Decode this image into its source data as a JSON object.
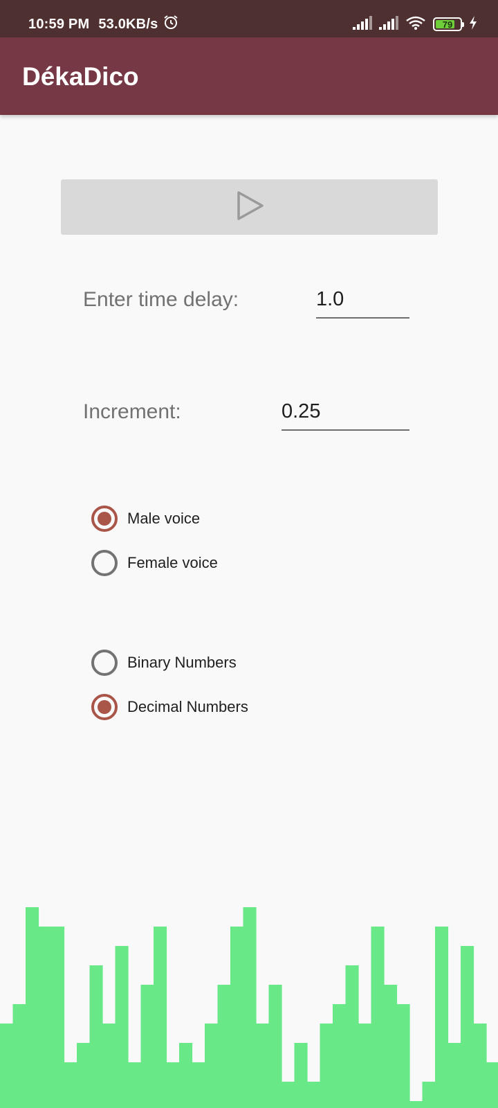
{
  "status_bar": {
    "time": "10:59 PM",
    "speed": "53.0KB/s",
    "battery": "79",
    "battery_level": 0.79,
    "icons": [
      "alarm-icon",
      "signal-icon",
      "signal-icon",
      "wifi-icon",
      "battery-icon",
      "charging-icon"
    ]
  },
  "app_bar": {
    "title": "DékaDico"
  },
  "play_button": {
    "icon": "play-icon"
  },
  "settings": {
    "delay_label": "Enter time delay:",
    "delay_value": "1.0",
    "increment_label": "Increment:",
    "increment_value": "0.25"
  },
  "voice_options": [
    {
      "label": "Male voice",
      "checked": true
    },
    {
      "label": "Female voice",
      "checked": false
    }
  ],
  "number_options": [
    {
      "label": "Binary Numbers",
      "checked": false
    },
    {
      "label": "Decimal Numbers",
      "checked": true
    }
  ],
  "visualizer": {
    "color": "#68e886",
    "levels": [
      4,
      5,
      10,
      9,
      9,
      2,
      3,
      7,
      4,
      8,
      2,
      6,
      9,
      2,
      3,
      2,
      4,
      6,
      9,
      10,
      4,
      6,
      1,
      3,
      1,
      4,
      5,
      7,
      4,
      9,
      6,
      5,
      0,
      1,
      9,
      3,
      8,
      4,
      2
    ]
  },
  "colors": {
    "status_bar": "#4f3030",
    "app_bar": "#763845",
    "accent": "#a95548",
    "background": "#f9f9f9"
  }
}
